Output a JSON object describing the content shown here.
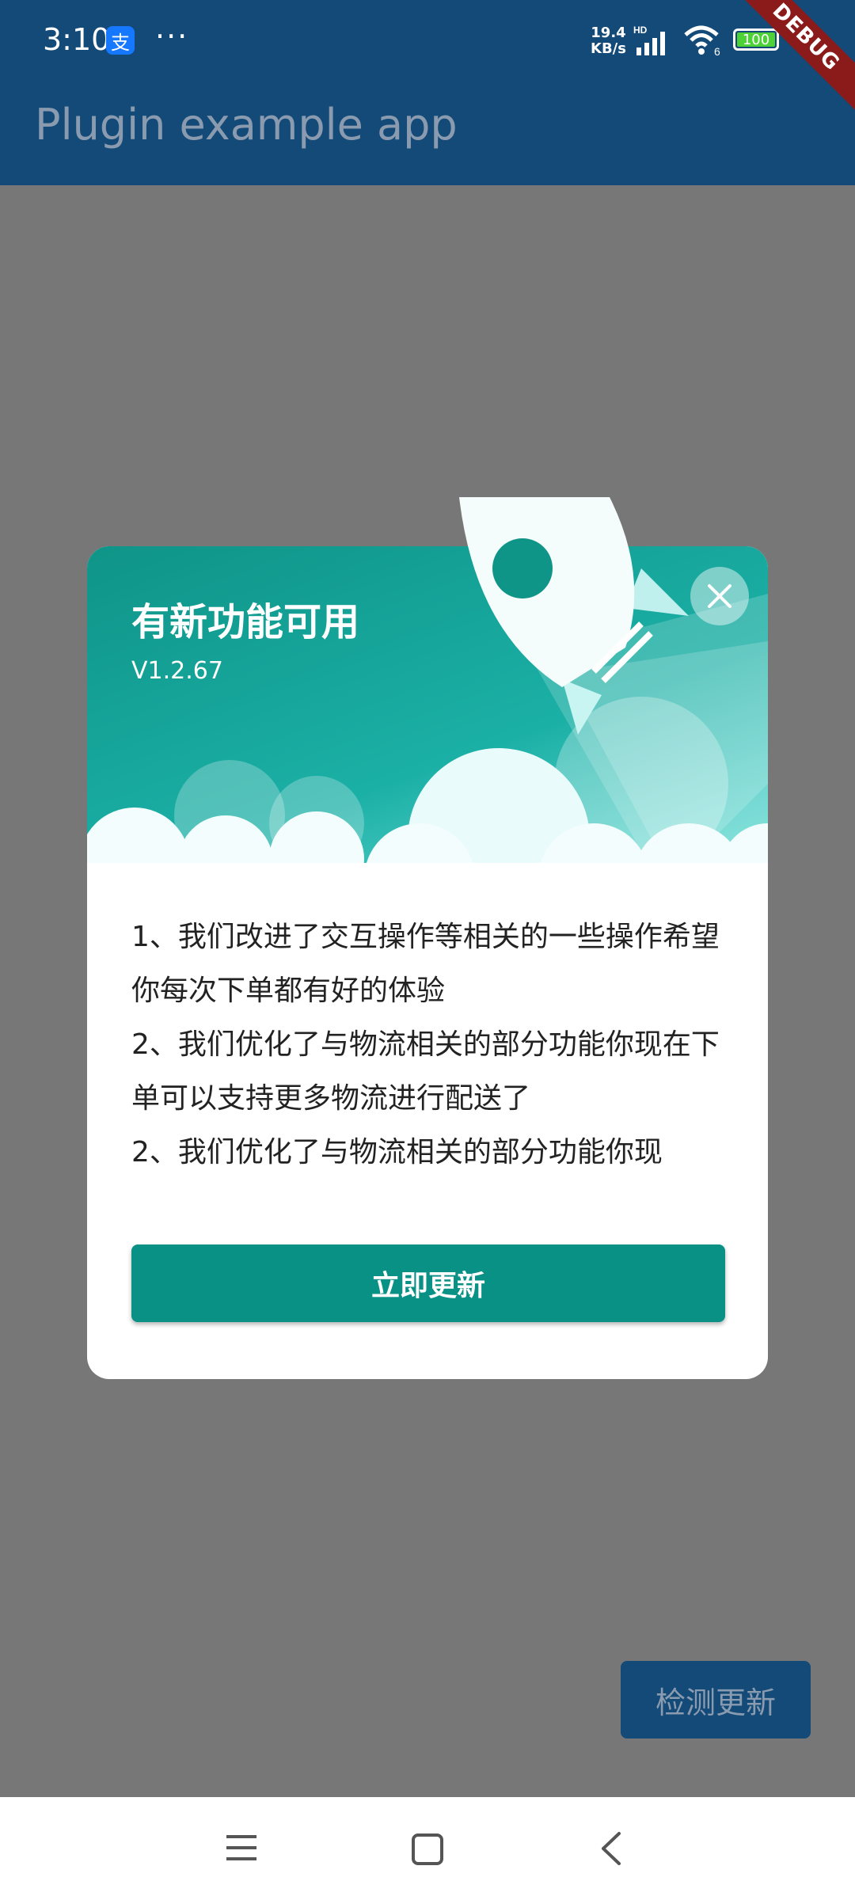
{
  "status_bar": {
    "time": "3:10",
    "alipay_glyph": "支",
    "more": "···",
    "speed_value": "19.4",
    "speed_unit": "KB/s",
    "signal_label": "HD",
    "battery": "100",
    "icons": [
      "alipay-icon",
      "signal-icon",
      "wifi-icon",
      "battery-icon"
    ]
  },
  "app_bar": {
    "title": "Plugin example app",
    "debug_label": "DEBUG"
  },
  "dialog": {
    "title": "有新功能可用",
    "version": "V1.2.67",
    "lines": [
      "1、我们改进了交互操作等相关的一些操作希望你每次下单都有好的体验",
      "2、我们优化了与物流相关的部分功能你现在下单可以支持更多物流进行配送了",
      "2、我们优化了与物流相关的部分功能你现"
    ],
    "update_button": "立即更新",
    "close_icon": "close-icon",
    "header_colors": [
      "#0f9488",
      "#1bb0a6",
      "#79e3dd"
    ]
  },
  "page": {
    "check_button": "检测更新"
  },
  "nav_bar": {
    "icons": [
      "menu-icon",
      "home-icon",
      "back-icon"
    ]
  }
}
